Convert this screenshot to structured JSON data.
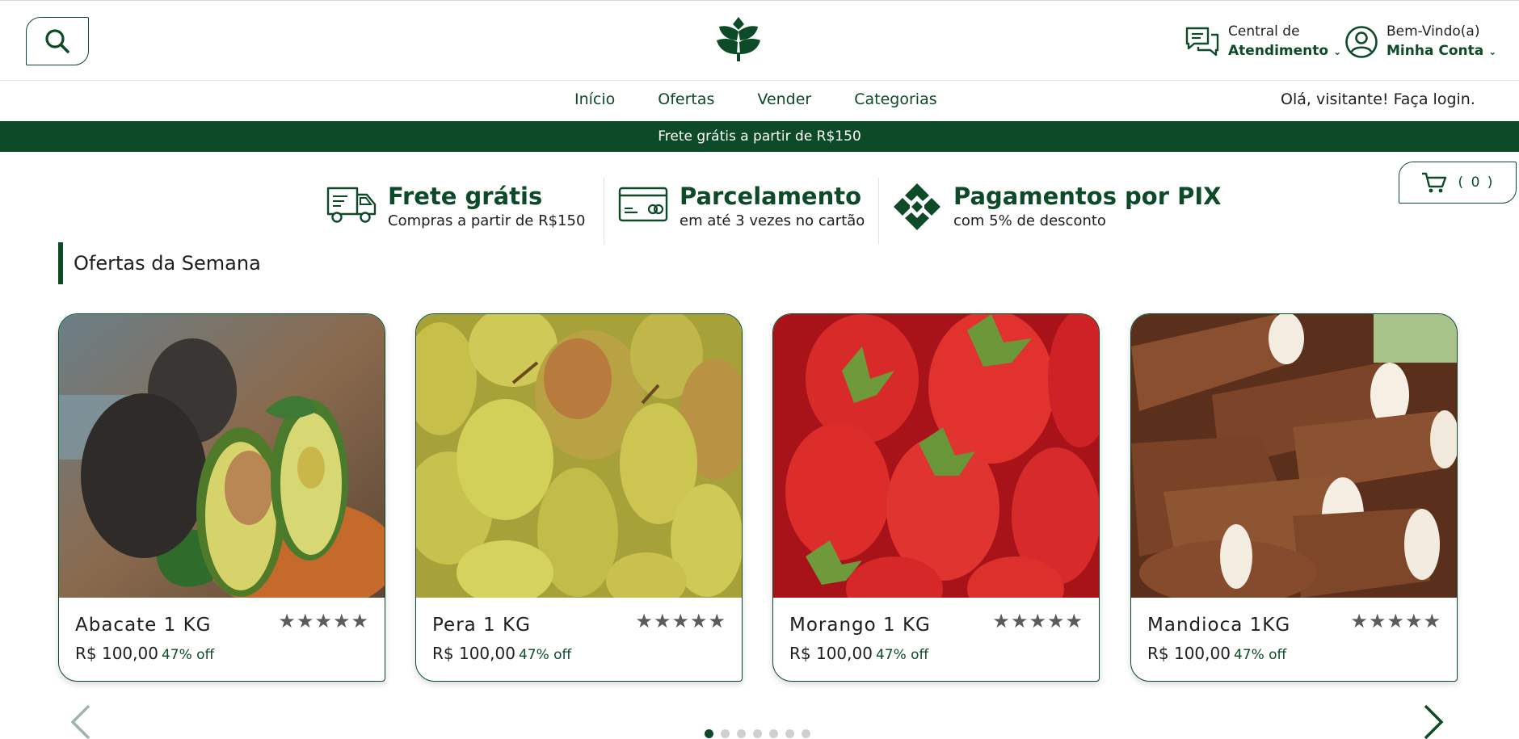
{
  "header": {
    "help_line1": "Central de",
    "help_line2": "Atendimento",
    "account_line1": "Bem-Vindo(a)",
    "account_line2": "Minha Conta"
  },
  "nav": {
    "links": [
      "Início",
      "Ofertas",
      "Vender",
      "Categorias"
    ],
    "login": "Olá, visitante! Faça login."
  },
  "banner": {
    "text": "Frete grátis a partir de R$150"
  },
  "features": [
    {
      "icon": "truck-icon",
      "title": "Frete grátis",
      "subtitle": "Compras a partir de R$150"
    },
    {
      "icon": "credit-card-icon",
      "title": "Parcelamento",
      "subtitle": "em até 3 vezes no cartão"
    },
    {
      "icon": "pix-icon",
      "title": "Pagamentos por PIX",
      "subtitle": "com 5% de desconto"
    }
  ],
  "cart": {
    "count": "( 0 )"
  },
  "section": {
    "title": "Ofertas da Semana"
  },
  "products": [
    {
      "name": "Abacate 1 KG",
      "price": "R$ 100,00",
      "discount": "47% off",
      "rating": 5,
      "image": "avocado"
    },
    {
      "name": "Pera 1 KG",
      "price": "R$ 100,00",
      "discount": "47% off",
      "rating": 5,
      "image": "pears"
    },
    {
      "name": "Morango 1 KG",
      "price": "R$ 100,00",
      "discount": "47% off",
      "rating": 5,
      "image": "strawberries"
    },
    {
      "name": "Mandioca 1KG",
      "price": "R$ 100,00",
      "discount": "47% off",
      "rating": 5,
      "image": "cassava"
    }
  ],
  "carousel": {
    "page_count": 7,
    "active_index": 0
  },
  "colors": {
    "brand": "#0d4a27",
    "star": "#5b5b5b"
  }
}
